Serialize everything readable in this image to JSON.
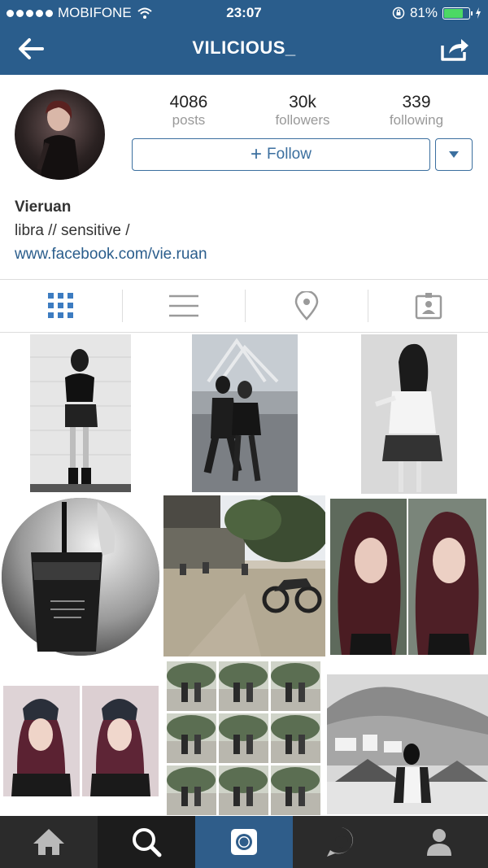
{
  "status_bar": {
    "carrier": "MOBIFONE",
    "time": "23:07",
    "battery": "81%",
    "battery_level": 0.81
  },
  "nav": {
    "title": "VILICIOUS_",
    "back_icon": "back-arrow-icon",
    "share_icon": "share-icon"
  },
  "profile": {
    "stats": [
      {
        "value": "4086",
        "label": "posts"
      },
      {
        "value": "30k",
        "label": "followers"
      },
      {
        "value": "339",
        "label": "following"
      }
    ],
    "follow_label": "Follow",
    "name": "Vieruan",
    "bio": "libra // sensitive /",
    "website": "www.facebook.com/vie.ruan"
  },
  "view_tabs": [
    "grid-view-icon",
    "list-view-icon",
    "map-pin-icon",
    "tagged-photos-icon"
  ],
  "tab_bar": [
    "home-icon",
    "search-icon",
    "camera-icon",
    "activity-heart-icon",
    "profile-icon"
  ],
  "colors": {
    "header": "#2a5d8c",
    "accent": "#3b6f9f",
    "tabbar": "#2b2b2b",
    "tabbar_active": "#2f5d8a"
  }
}
